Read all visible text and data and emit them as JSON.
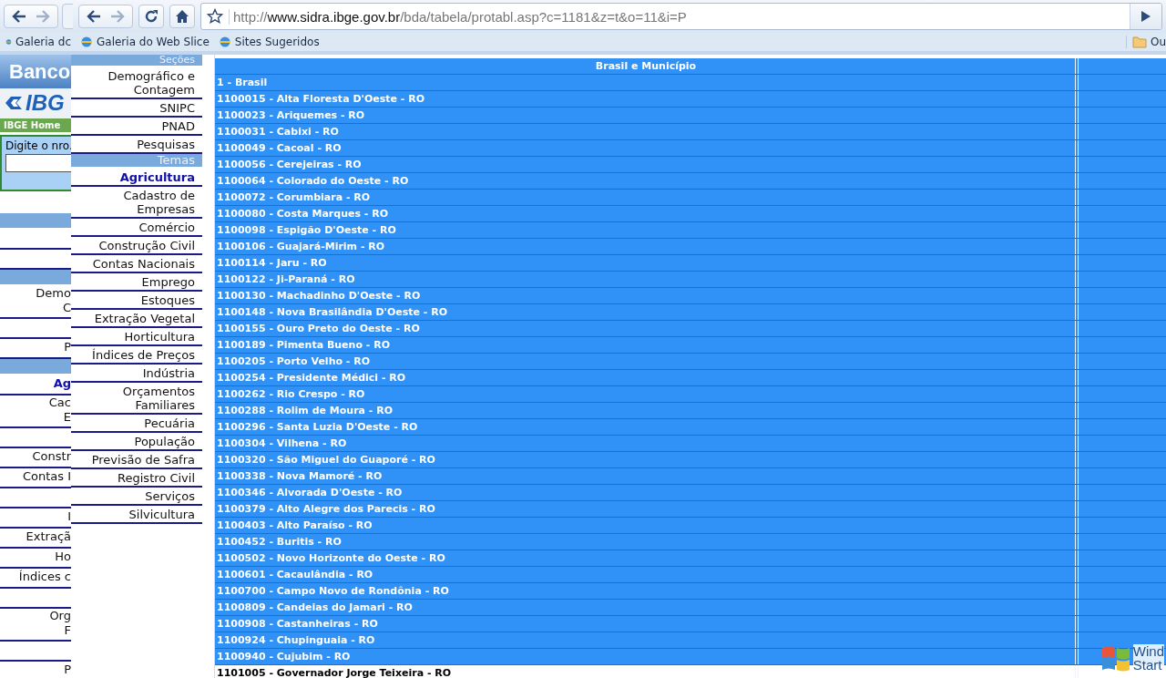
{
  "browser_behind": {
    "bookmark": "Galeria dc"
  },
  "browser": {
    "url": {
      "scheme": "http://",
      "host": "www.sidra.ibge.gov.br",
      "path": "/bda/tabela/protabl.asp?c=1181&z=t&o=11&i=P"
    },
    "bookmarks": [
      "Galeria do Web Slice",
      "Sites Sugeridos"
    ],
    "other_bookmarks": "Ou"
  },
  "page_behind": {
    "banner": "Banco",
    "logo": "IBG",
    "home_link": "IBGE Home",
    "search_label": "Digite o nro.",
    "rows": [
      {
        "kind": "bar"
      },
      {
        "kind": "item",
        "lines": []
      },
      {
        "kind": "item",
        "lines": []
      },
      {
        "kind": "bar"
      },
      {
        "kind": "item",
        "lines": [
          "Demo",
          "C"
        ]
      },
      {
        "kind": "item",
        "lines": []
      },
      {
        "kind": "item",
        "lines": [
          "P"
        ]
      },
      {
        "kind": "bar"
      },
      {
        "kind": "current",
        "lines": [
          "Ag"
        ]
      },
      {
        "kind": "item",
        "lines": [
          "Cac",
          "E"
        ]
      },
      {
        "kind": "item",
        "lines": []
      },
      {
        "kind": "item",
        "lines": [
          "Constr"
        ]
      },
      {
        "kind": "item",
        "lines": [
          "Contas I"
        ]
      },
      {
        "kind": "item",
        "lines": []
      },
      {
        "kind": "item",
        "lines": [
          "I"
        ]
      },
      {
        "kind": "item",
        "lines": [
          "Extraçã"
        ]
      },
      {
        "kind": "item",
        "lines": [
          "Ho"
        ]
      },
      {
        "kind": "item",
        "lines": [
          "Índices c"
        ]
      },
      {
        "kind": "item",
        "lines": []
      },
      {
        "kind": "item",
        "lines": [
          "Org",
          "F"
        ]
      },
      {
        "kind": "item",
        "lines": []
      },
      {
        "kind": "item",
        "lines": [
          "P"
        ]
      }
    ]
  },
  "menu": [
    {
      "kind": "header",
      "label": "Seções"
    },
    {
      "kind": "item",
      "label": "Demográfico e Contagem",
      "selected": false
    },
    {
      "kind": "item",
      "label": "SNIPC",
      "selected": false
    },
    {
      "kind": "item",
      "label": "PNAD",
      "selected": false
    },
    {
      "kind": "item",
      "label": "Pesquisas",
      "selected": false
    },
    {
      "kind": "header",
      "label": "Temas"
    },
    {
      "kind": "item",
      "label": "Agricultura",
      "selected": true
    },
    {
      "kind": "item",
      "label": "Cadastro de Empresas",
      "selected": false
    },
    {
      "kind": "item",
      "label": "Comércio",
      "selected": false
    },
    {
      "kind": "item",
      "label": "Construção Civil",
      "selected": false
    },
    {
      "kind": "item",
      "label": "Contas Nacionais",
      "selected": false
    },
    {
      "kind": "item",
      "label": "Emprego",
      "selected": false
    },
    {
      "kind": "item",
      "label": "Estoques",
      "selected": false
    },
    {
      "kind": "item",
      "label": "Extração Vegetal",
      "selected": false
    },
    {
      "kind": "item",
      "label": "Horticultura",
      "selected": false
    },
    {
      "kind": "item",
      "label": "Índices de Preços",
      "selected": false
    },
    {
      "kind": "item",
      "label": "Indústria",
      "selected": false
    },
    {
      "kind": "item",
      "label": "Orçamentos Familiares",
      "selected": false
    },
    {
      "kind": "item",
      "label": "Pecuária",
      "selected": false
    },
    {
      "kind": "item",
      "label": "População",
      "selected": false
    },
    {
      "kind": "item",
      "label": "Previsão de Safra",
      "selected": false
    },
    {
      "kind": "item",
      "label": "Registro Civil",
      "selected": false
    },
    {
      "kind": "item",
      "label": "Serviços",
      "selected": false
    },
    {
      "kind": "item",
      "label": "Silvicultura",
      "selected": false
    }
  ],
  "table": {
    "columns": [
      "Brasil e Município"
    ],
    "rows": [
      {
        "text": "1 - Brasil",
        "selected": true
      },
      {
        "text": "1100015 - Alta Floresta D'Oeste - RO",
        "selected": true
      },
      {
        "text": "1100023 - Ariquemes - RO",
        "selected": true
      },
      {
        "text": "1100031 - Cabixi - RO",
        "selected": true
      },
      {
        "text": "1100049 - Cacoal - RO",
        "selected": true
      },
      {
        "text": "1100056 - Cerejeiras - RO",
        "selected": true
      },
      {
        "text": "1100064 - Colorado do Oeste - RO",
        "selected": true
      },
      {
        "text": "1100072 - Corumbiara - RO",
        "selected": true
      },
      {
        "text": "1100080 - Costa Marques - RO",
        "selected": true
      },
      {
        "text": "1100098 - Espigão D'Oeste - RO",
        "selected": true
      },
      {
        "text": "1100106 - Guajará-Mirim - RO",
        "selected": true
      },
      {
        "text": "1100114 - Jaru - RO",
        "selected": true
      },
      {
        "text": "1100122 - Ji-Paraná - RO",
        "selected": true
      },
      {
        "text": "1100130 - Machadinho D'Oeste - RO",
        "selected": true
      },
      {
        "text": "1100148 - Nova Brasilândia D'Oeste - RO",
        "selected": true
      },
      {
        "text": "1100155 - Ouro Preto do Oeste - RO",
        "selected": true
      },
      {
        "text": "1100189 - Pimenta Bueno - RO",
        "selected": true
      },
      {
        "text": "1100205 - Porto Velho - RO",
        "selected": true
      },
      {
        "text": "1100254 - Presidente Médici - RO",
        "selected": true
      },
      {
        "text": "1100262 - Rio Crespo - RO",
        "selected": true
      },
      {
        "text": "1100288 - Rolim de Moura - RO",
        "selected": true
      },
      {
        "text": "1100296 - Santa Luzia D'Oeste - RO",
        "selected": true
      },
      {
        "text": "1100304 - Vilhena - RO",
        "selected": true
      },
      {
        "text": "1100320 - São Miguel do Guaporé - RO",
        "selected": true
      },
      {
        "text": "1100338 - Nova Mamoré - RO",
        "selected": true
      },
      {
        "text": "1100346 - Alvorada D'Oeste - RO",
        "selected": true
      },
      {
        "text": "1100379 - Alto Alegre dos Parecis - RO",
        "selected": true
      },
      {
        "text": "1100403 - Alto Paraíso - RO",
        "selected": true
      },
      {
        "text": "1100452 - Buritis - RO",
        "selected": true
      },
      {
        "text": "1100502 - Novo Horizonte do Oeste - RO",
        "selected": true
      },
      {
        "text": "1100601 - Cacaulândia - RO",
        "selected": true
      },
      {
        "text": "1100700 - Campo Novo de Rondônia - RO",
        "selected": true
      },
      {
        "text": "1100809 - Candeias do Jamari - RO",
        "selected": true
      },
      {
        "text": "1100908 - Castanheiras - RO",
        "selected": true
      },
      {
        "text": "1100924 - Chupinguaia - RO",
        "selected": true
      },
      {
        "text": "1100940 - Cujubim - RO",
        "selected": true
      },
      {
        "text": "1101005 - Governador Jorge Teixeira - RO",
        "selected": false
      }
    ]
  },
  "os_overlay": {
    "lines": [
      "Wind",
      "Start"
    ]
  }
}
